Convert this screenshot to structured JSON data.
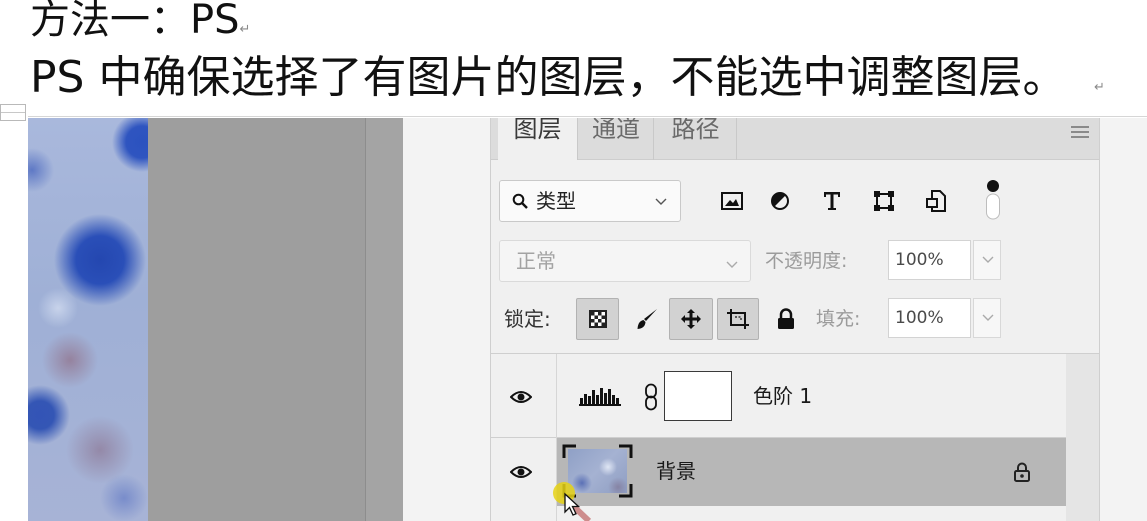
{
  "document": {
    "heading": "方法一：PS",
    "instruction": "PS 中确保选择了有图片的图层，不能选中调整图层。",
    "paragraph_mark": "↵"
  },
  "panel": {
    "tabs": [
      {
        "label": "图层",
        "active": true
      },
      {
        "label": "通道",
        "active": false
      },
      {
        "label": "路径",
        "active": false
      }
    ],
    "menu_icon": "panel-menu-icon",
    "filter": {
      "icon": "search-icon",
      "value": "类型"
    },
    "filter_icons": [
      "pixel-layer-filter-icon",
      "adjustment-layer-filter-icon",
      "type-layer-filter-icon",
      "shape-layer-filter-icon",
      "smart-object-filter-icon",
      "filter-toggle-icon"
    ],
    "blend_mode": "正常",
    "opacity": {
      "label": "不透明度:",
      "value": "100%"
    },
    "lock": {
      "label": "锁定:",
      "buttons": [
        {
          "icon": "lock-transparent-pixels-icon",
          "pressed": true
        },
        {
          "icon": "lock-image-pixels-icon",
          "pressed": false
        },
        {
          "icon": "lock-position-icon",
          "pressed": true
        },
        {
          "icon": "lock-artboard-icon",
          "pressed": true
        },
        {
          "icon": "lock-all-icon",
          "pressed": false
        }
      ]
    },
    "fill": {
      "label": "填充:",
      "value": "100%"
    },
    "layers": [
      {
        "name": "色阶 1",
        "kind": "adjustment",
        "icon": "levels-icon",
        "visible": true,
        "selected": false,
        "locked": false
      },
      {
        "name": "背景",
        "kind": "pixel",
        "visible": true,
        "selected": true,
        "locked": true
      }
    ]
  },
  "colors": {
    "selected_row": "#b7b7b7",
    "panel_bg": "#f0f0f0",
    "cursor_highlight": "#e6d214"
  }
}
